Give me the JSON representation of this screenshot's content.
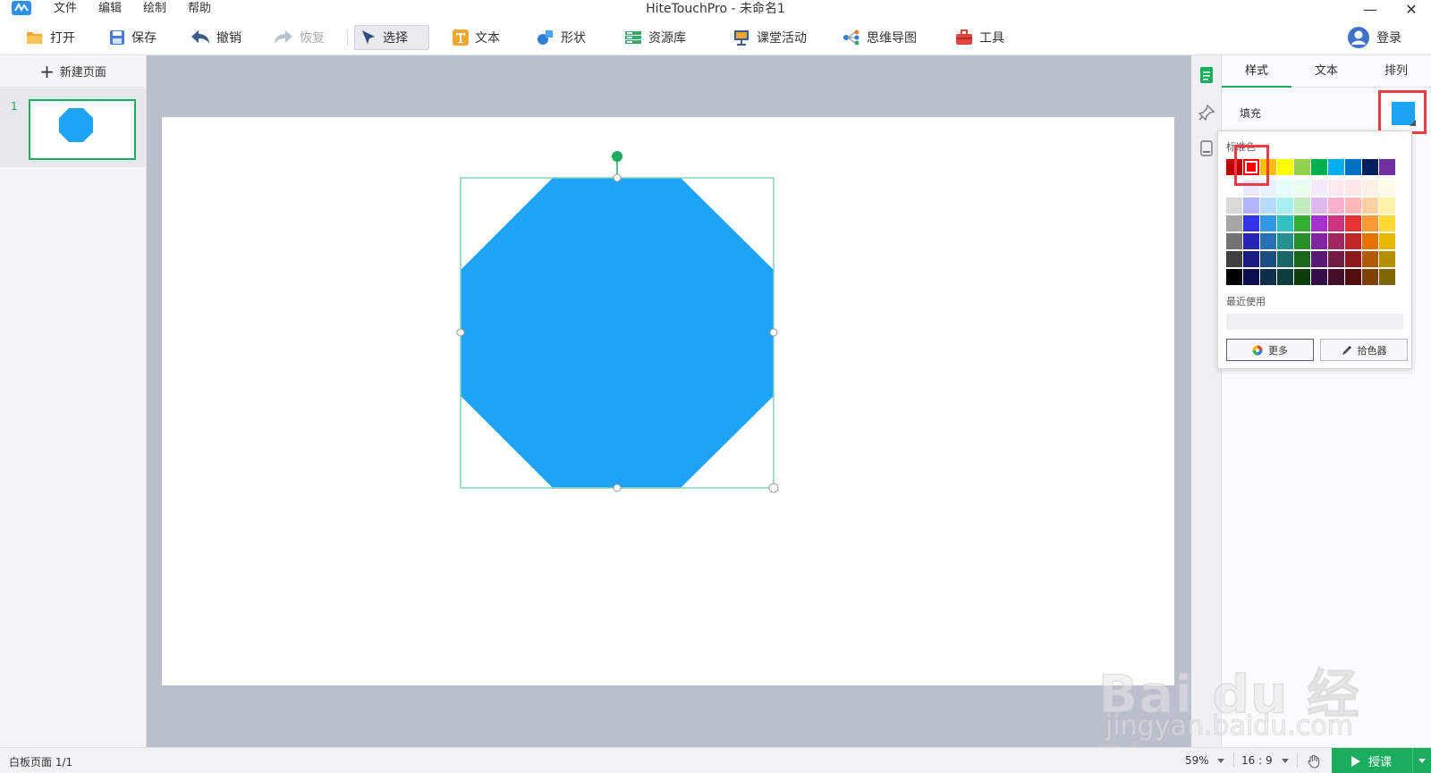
{
  "window": {
    "title": "HiteTouchPro - 未命名1",
    "menu": [
      "文件",
      "编辑",
      "绘制",
      "帮助"
    ],
    "minimize": "—",
    "close": "✕"
  },
  "toolbar": {
    "open": "打开",
    "save": "保存",
    "undo": "撤销",
    "redo": "恢复",
    "select": "选择",
    "text": "文本",
    "shape": "形状",
    "resources": "资源库",
    "class_activity": "课堂活动",
    "mindmap": "思维导图",
    "tools": "工具",
    "login": "登录"
  },
  "pages": {
    "new_page": "新建页面",
    "items": [
      {
        "number": "1"
      }
    ]
  },
  "canvas": {
    "shape": {
      "type": "octagon",
      "fill": "#1ea3f7",
      "selection_color": "#7fd3b8",
      "rotate_handle_color": "#1aad5e"
    }
  },
  "properties": {
    "tabs": [
      "样式",
      "文本",
      "排列"
    ],
    "active_tab": 0,
    "fill_label": "填充",
    "fill_color": "#1ea3f7"
  },
  "color_popup": {
    "standard_label": "标准色",
    "standard_colors": [
      "#c00000",
      "#ff0000",
      "#ffc000",
      "#ffff00",
      "#92d050",
      "#00b050",
      "#00b0f0",
      "#0070c0",
      "#002060",
      "#7030a0"
    ],
    "selected_index": 1,
    "shade_grid": [
      [
        "#ffffff",
        "#e8e8ff",
        "#e6f2ff",
        "#e6ffff",
        "#e8fff0",
        "#f5e8ff",
        "#ffe8f0",
        "#ffe8e8",
        "#fff0e6",
        "#fffbe6"
      ],
      [
        "#d9d9d9",
        "#b3b3ff",
        "#b3dcff",
        "#a8f0f0",
        "#c0ecc0",
        "#e0b8f0",
        "#ffb0cc",
        "#ffb8b8",
        "#ffd0a0",
        "#fff2a8"
      ],
      [
        "#a6a6a6",
        "#3333e6",
        "#3399e6",
        "#33c0c0",
        "#33b033",
        "#a333cc",
        "#cc3380",
        "#e63333",
        "#ff9933",
        "#ffd933"
      ],
      [
        "#737373",
        "#2626b3",
        "#2670b3",
        "#268f8f",
        "#268f26",
        "#7f26a0",
        "#a02660",
        "#c02626",
        "#e67300",
        "#e6b800"
      ],
      [
        "#404040",
        "#1a1a80",
        "#1a4d80",
        "#1a6666",
        "#1a661a",
        "#591a73",
        "#731a45",
        "#8c1a1a",
        "#b35900",
        "#b38f00"
      ],
      [
        "#000000",
        "#0d0d4d",
        "#0d2d4d",
        "#0d3d3d",
        "#0d3d0d",
        "#330d45",
        "#450d29",
        "#540d0d",
        "#804000",
        "#806600"
      ]
    ],
    "recent_label": "最近使用",
    "more_button": "更多",
    "picker_button": "拾色器"
  },
  "statusbar": {
    "page_info": "白板页面 1/1",
    "zoom": "59%",
    "ratio": "16 : 9",
    "present": "授课",
    "accent": "#1aad5e"
  },
  "watermark": {
    "line1": "Bai du 经验",
    "line2": "jingyan.baidu.com"
  }
}
